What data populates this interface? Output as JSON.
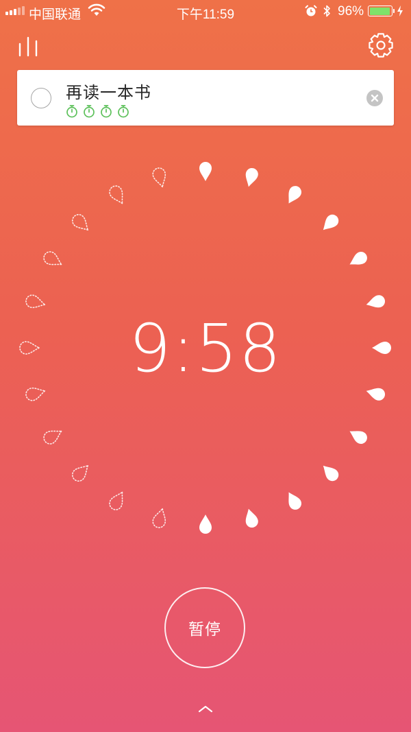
{
  "status_bar": {
    "carrier": "中国联通",
    "time": "下午11:59",
    "battery_percent": "96%",
    "battery_level": 0.96,
    "battery_color": "#7FE26A",
    "signal_bars": 5,
    "signal_active": 3
  },
  "toolbar": {
    "stats_icon": "bar-chart-icon",
    "settings_icon": "gear-icon"
  },
  "task": {
    "title": "再读一本书",
    "pomodoro_count": 4,
    "pomodoro_color": "#5CC05A",
    "clear_icon": "clear-icon"
  },
  "timer": {
    "display": "9:58",
    "total_drops": 24,
    "completed_drops": 13
  },
  "controls": {
    "pause_label": "暂停",
    "expand_icon": "chevron-up-icon"
  },
  "colors": {
    "gradient_top": "#EF7148",
    "gradient_bottom": "#E65574"
  }
}
